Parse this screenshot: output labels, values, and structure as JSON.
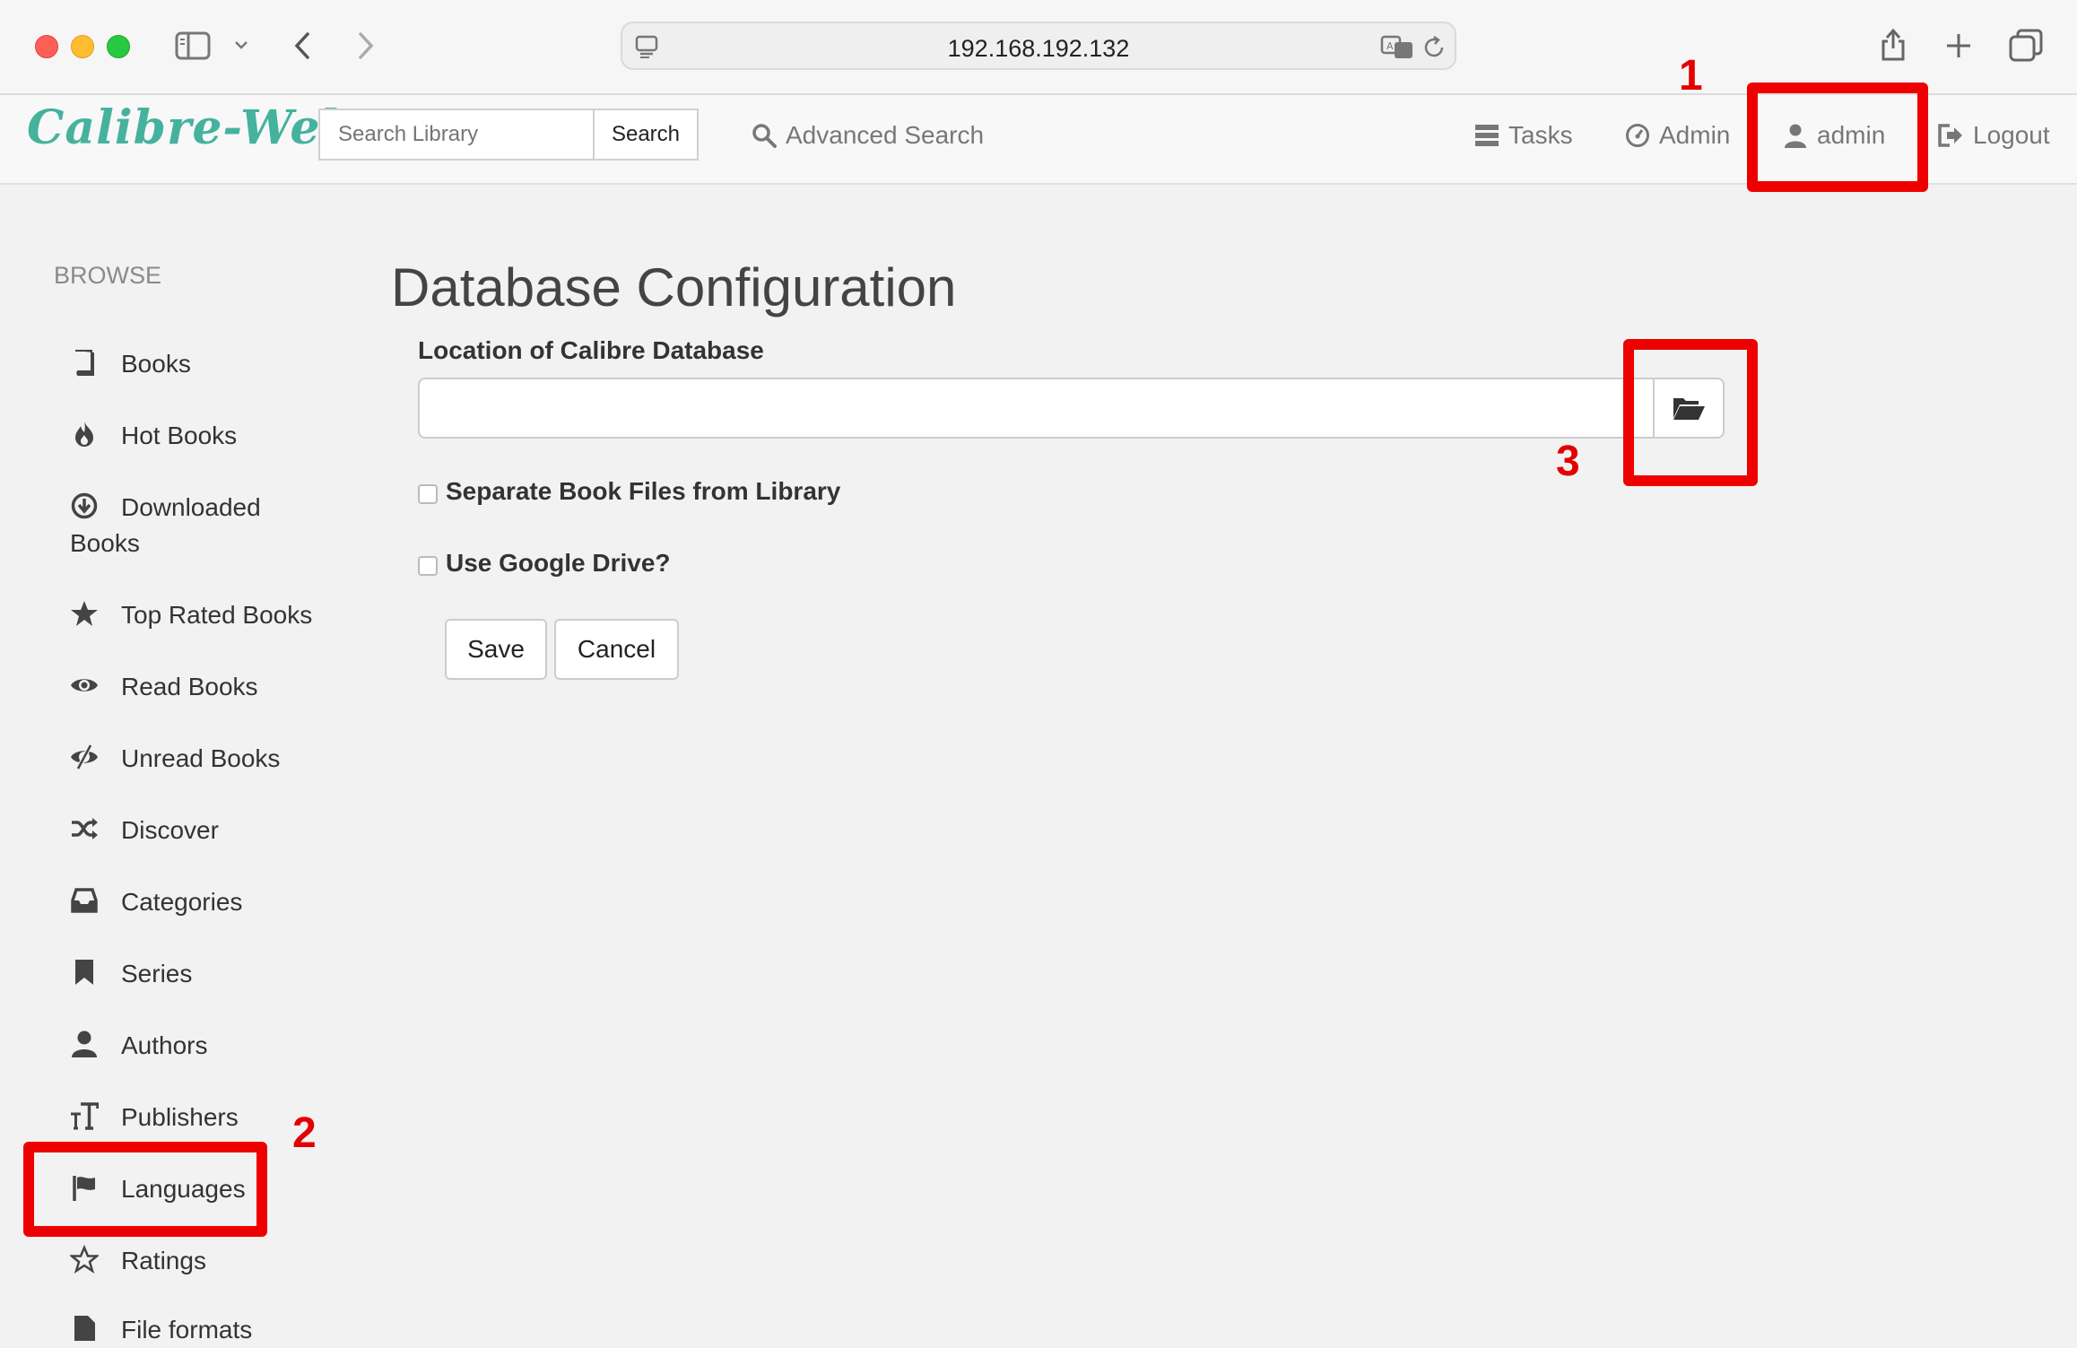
{
  "browser": {
    "url": "192.168.192.132"
  },
  "navbar": {
    "brand": "Calibre-Web",
    "search_placeholder": "Search Library",
    "search_button": "Search",
    "advanced_search": "Advanced Search",
    "tasks": "Tasks",
    "admin": "Admin",
    "user": "admin",
    "logout": "Logout"
  },
  "sidebar": {
    "heading": "BROWSE",
    "items": [
      {
        "label": "Books",
        "icon": "book-icon"
      },
      {
        "label": "Hot Books",
        "icon": "fire-icon"
      },
      {
        "label": "Downloaded Books",
        "icon": "download-circle-icon"
      },
      {
        "label": "Top Rated Books",
        "icon": "star-icon"
      },
      {
        "label": "Read Books",
        "icon": "eye-icon"
      },
      {
        "label": "Unread Books",
        "icon": "eye-slash-icon"
      },
      {
        "label": "Discover",
        "icon": "shuffle-icon"
      },
      {
        "label": "Categories",
        "icon": "inbox-icon"
      },
      {
        "label": "Series",
        "icon": "bookmark-icon"
      },
      {
        "label": "Authors",
        "icon": "user-icon"
      },
      {
        "label": "Publishers",
        "icon": "text-size-icon"
      },
      {
        "label": "Languages",
        "icon": "flag-icon"
      },
      {
        "label": "Ratings",
        "icon": "star-outline-icon"
      },
      {
        "label": "File formats",
        "icon": "file-icon"
      }
    ]
  },
  "main": {
    "title": "Database Configuration",
    "db_location_label": "Location of Calibre Database",
    "db_location_value": "",
    "separate_files_label": "Separate Book Files from Library",
    "google_drive_label": "Use Google Drive?",
    "save_button": "Save",
    "cancel_button": "Cancel"
  },
  "annotations": {
    "marker_1": "1",
    "marker_2": "2",
    "marker_3": "3",
    "color": "#ee0000"
  }
}
